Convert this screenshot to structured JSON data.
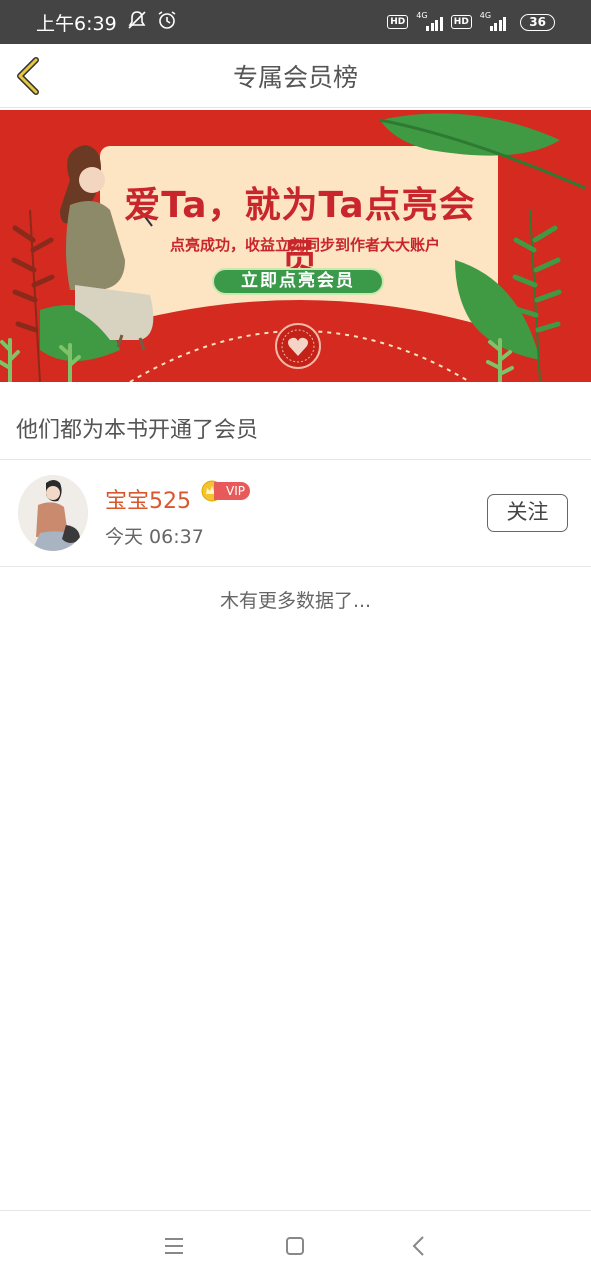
{
  "status_bar": {
    "time": "上午6:39",
    "network_type_1": "4G",
    "network_type_2": "4G",
    "hd_label": "HD",
    "battery": "36"
  },
  "header": {
    "title": "专属会员榜"
  },
  "banner": {
    "headline": "爱Ta，就为Ta点亮会员",
    "subtitle": "点亮成功，收益立刻同步到作者大大账户",
    "cta_label": "立即点亮会员"
  },
  "section": {
    "title": "他们都为本书开通了会员"
  },
  "members": [
    {
      "username": "宝宝525",
      "badge": "VIP",
      "time": "今天 06:37",
      "follow_label": "关注"
    }
  ],
  "footer_text": "木有更多数据了...",
  "colors": {
    "accent_name": "#d9572d",
    "banner_red": "#d42a1f",
    "cta_green": "#3a9a4a",
    "back_arrow": "#e8c840"
  }
}
